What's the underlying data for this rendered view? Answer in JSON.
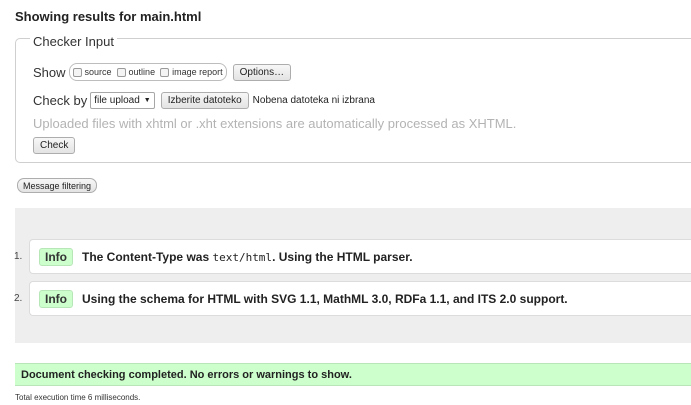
{
  "heading": "Showing results for main.html",
  "checker": {
    "legend": "Checker Input",
    "show_label": "Show",
    "show_options": [
      "source",
      "outline",
      "image report"
    ],
    "options_button": "Options…",
    "check_by_label": "Check by",
    "check_by_value": "file upload",
    "choose_file_button": "Izberite datoteko",
    "file_status": "Nobena datoteka ni izbrana",
    "hint": "Uploaded files with xhtml or .xht extensions are automatically processed as XHTML.",
    "check_button": "Check"
  },
  "message_filtering_button": "Message filtering",
  "messages": [
    {
      "number": "1.",
      "type": "Info",
      "text_before": "The Content-Type was ",
      "code": "text/html",
      "text_after": ". Using the HTML parser."
    },
    {
      "number": "2.",
      "type": "Info",
      "text": "Using the schema for HTML with SVG 1.1, MathML 3.0, RDFa 1.1, and ITS 2.0 support."
    }
  ],
  "completion": "Document checking completed. No errors or warnings to show.",
  "execution_time": "Total execution time 6 milliseconds.",
  "colors": {
    "info_badge": "#ccffcc",
    "success_bar": "#ccffcc",
    "results_panel": "#eeeeee"
  }
}
